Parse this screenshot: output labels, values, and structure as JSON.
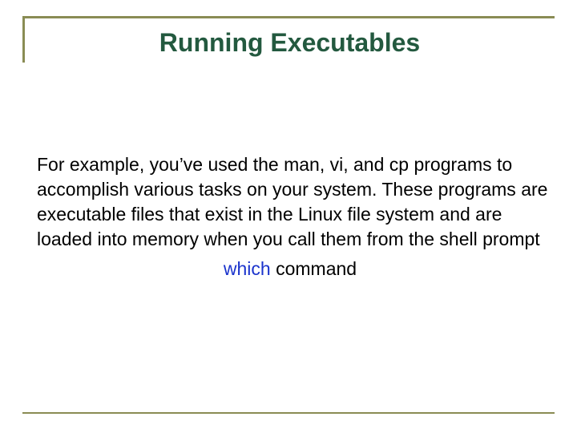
{
  "title": "Running Executables",
  "body_text": "For example, you’ve used the man, vi, and cp programs to accomplish various tasks on your system. These programs are executable files that exist in the Linux file system and are loaded into memory when you call them from the shell prompt",
  "command": {
    "name": "which",
    "arg": "  command"
  },
  "colors": {
    "title": "#23593f",
    "border": "#8a8c54",
    "command_name": "#1a33cc"
  }
}
